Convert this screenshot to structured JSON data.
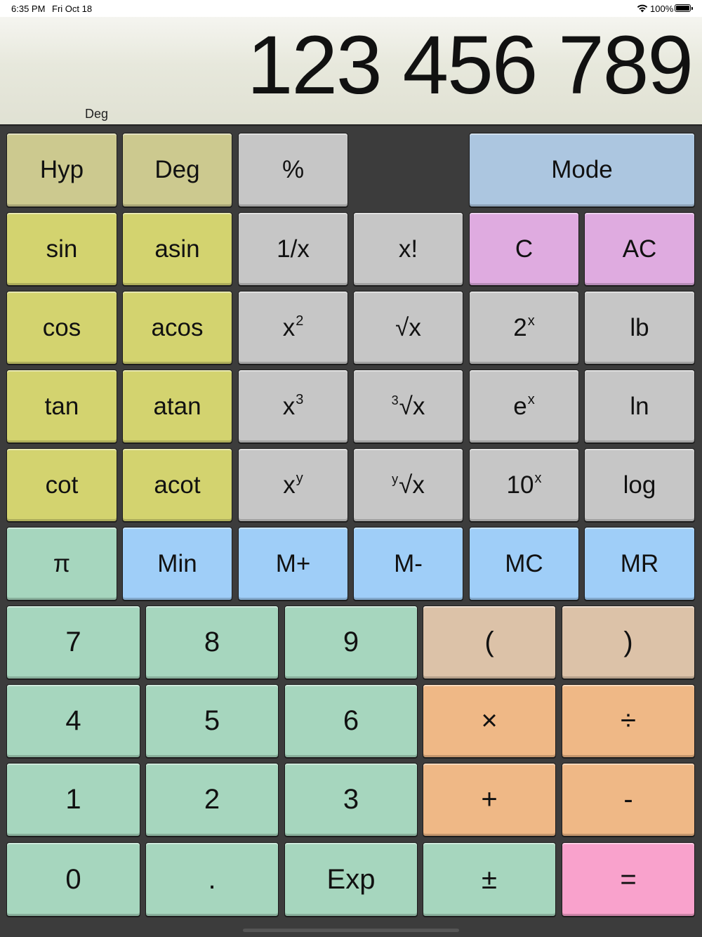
{
  "status_bar": {
    "time": "6:35 PM",
    "date": "Fri Oct 18",
    "battery_percent": "100%",
    "battery_level": 1.0
  },
  "display": {
    "value": "123 456 789",
    "angle_mode": "Deg"
  },
  "keys": {
    "hyp": "Hyp",
    "deg": "Deg",
    "percent": "%",
    "mode": "Mode",
    "sin": "sin",
    "asin": "asin",
    "reciprocal": "1/x",
    "factorial": "x!",
    "clear": "C",
    "all_clear": "AC",
    "cos": "cos",
    "acos": "acos",
    "square_base": "x",
    "square_exp": "2",
    "sqrt": "√x",
    "pow2_base": "2",
    "pow2_exp": "x",
    "lb": "lb",
    "tan": "tan",
    "atan": "atan",
    "cube_base": "x",
    "cube_exp": "3",
    "cbrt_index": "3",
    "cbrt": "√x",
    "exp_base": "e",
    "exp_exp": "x",
    "ln": "ln",
    "cot": "cot",
    "acot": "acot",
    "pow_base": "x",
    "pow_exp": "y",
    "yroot_index": "y",
    "yroot": "√x",
    "pow10_base": "10",
    "pow10_exp": "x",
    "log": "log",
    "pi": "π",
    "min": "Min",
    "m_plus": "M+",
    "m_minus": "M-",
    "mc": "MC",
    "mr": "MR",
    "d7": "7",
    "d8": "8",
    "d9": "9",
    "lparen": "(",
    "rparen": ")",
    "d4": "4",
    "d5": "5",
    "d6": "6",
    "multiply": "×",
    "divide": "÷",
    "d1": "1",
    "d2": "2",
    "d3": "3",
    "add": "+",
    "subtract": "-",
    "d0": "0",
    "decimal": ".",
    "exp": "Exp",
    "plus_minus": "±",
    "equals": "="
  },
  "colors": {
    "khaki": "#ccc98f",
    "trig_yellow": "#d3d36f",
    "function_gray": "#c6c6c6",
    "mode_blue": "#acc6e0",
    "memory_blue": "#9fcef8",
    "clear_pink": "#dfabe0",
    "digit_mint": "#a6d6be",
    "paren_tan": "#dcc2a8",
    "operator_orange": "#efb886",
    "equals_pink": "#f9a2cc"
  }
}
